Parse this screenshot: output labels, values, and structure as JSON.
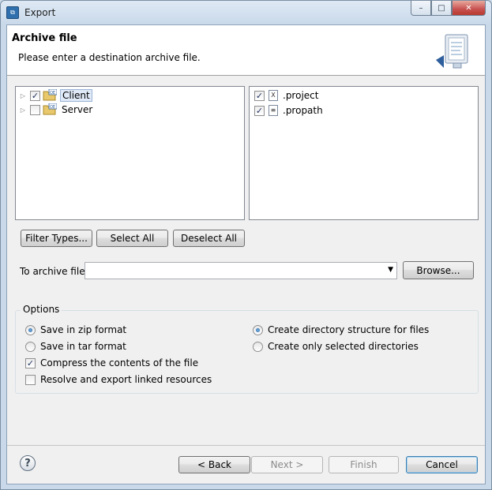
{
  "window": {
    "title": "Export",
    "app_icon": "eclipse-export-icon",
    "minimize_icon": "minimize-icon",
    "maximize_icon": "maximize-icon",
    "close_icon": "close-icon"
  },
  "banner": {
    "title": "Archive file",
    "description": "Please enter a destination archive file.",
    "icon": "export-archive-icon"
  },
  "left_tree": {
    "items": [
      {
        "label": "Client",
        "checked": true,
        "selected": true,
        "icon": "openedge-project-icon"
      },
      {
        "label": "Server",
        "checked": false,
        "selected": false,
        "icon": "openedge-project-icon"
      }
    ]
  },
  "right_list": {
    "items": [
      {
        "label": ".project",
        "checked": true,
        "icon": "xml-file-icon"
      },
      {
        "label": ".propath",
        "checked": true,
        "icon": "text-file-icon"
      }
    ]
  },
  "buttons": {
    "filter_types": "Filter Types...",
    "select_all": "Select All",
    "deselect_all": "Deselect All",
    "browse": "Browse..."
  },
  "archive": {
    "label": "To archive file:",
    "value": ""
  },
  "options": {
    "title": "Options",
    "save_zip": "Save in zip format",
    "save_tar": "Save in tar format",
    "compress": "Compress the contents of the file",
    "resolve_linked": "Resolve and export linked resources",
    "create_structure": "Create directory structure for files",
    "create_selected": "Create only selected directories",
    "format_selected": "zip",
    "compress_checked": true,
    "resolve_checked": false,
    "structure_selected": "full"
  },
  "footer": {
    "help_icon": "help-icon",
    "back": "< Back",
    "next": "Next >",
    "finish": "Finish",
    "cancel": "Cancel"
  }
}
